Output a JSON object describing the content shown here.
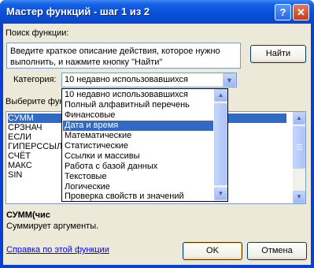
{
  "window": {
    "title": "Мастер функций - шаг 1 из 2",
    "help_glyph": "?",
    "close_glyph": "✕"
  },
  "search": {
    "label": "Поиск функции:",
    "description": "Введите краткое описание действия, которое нужно выполнить, и нажмите кнопку \"Найти\"",
    "find_button": "Найти"
  },
  "category": {
    "label": "Категория:",
    "selected": "10 недавно использовавшихся",
    "options": [
      "10 недавно использовавшихся",
      "Полный алфавитный перечень",
      "Финансовые",
      "Дата и время",
      "Математические",
      "Статистические",
      "Ссылки и массивы",
      "Работа с базой данных",
      "Текстовые",
      "Логические",
      "Проверка свойств и значений"
    ],
    "highlighted_option": "Дата и время"
  },
  "functions": {
    "label": "Выберите функ",
    "items": [
      "СУММ",
      "СРЗНАЧ",
      "ЕСЛИ",
      "ГИПЕРССЫЛ",
      "СЧЁТ",
      "МАКС",
      "SIN"
    ],
    "selected": "СУММ"
  },
  "signature": "СУММ(чис",
  "summary": "Суммирует аргументы.",
  "footer": {
    "help_link": "Справка по этой функции",
    "ok": "OK",
    "cancel": "Отмена"
  },
  "colors": {
    "title_bar": "#0a4fd8",
    "selection": "#316ac5",
    "dialog_face": "#ece9d8",
    "link": "#0000ff",
    "close_button": "#c34019"
  },
  "icons": {
    "help": "question-icon",
    "close": "close-icon",
    "combo_arrow": "chevron-down-icon",
    "scroll_up": "arrow-up-icon",
    "scroll_down": "arrow-down-icon"
  }
}
